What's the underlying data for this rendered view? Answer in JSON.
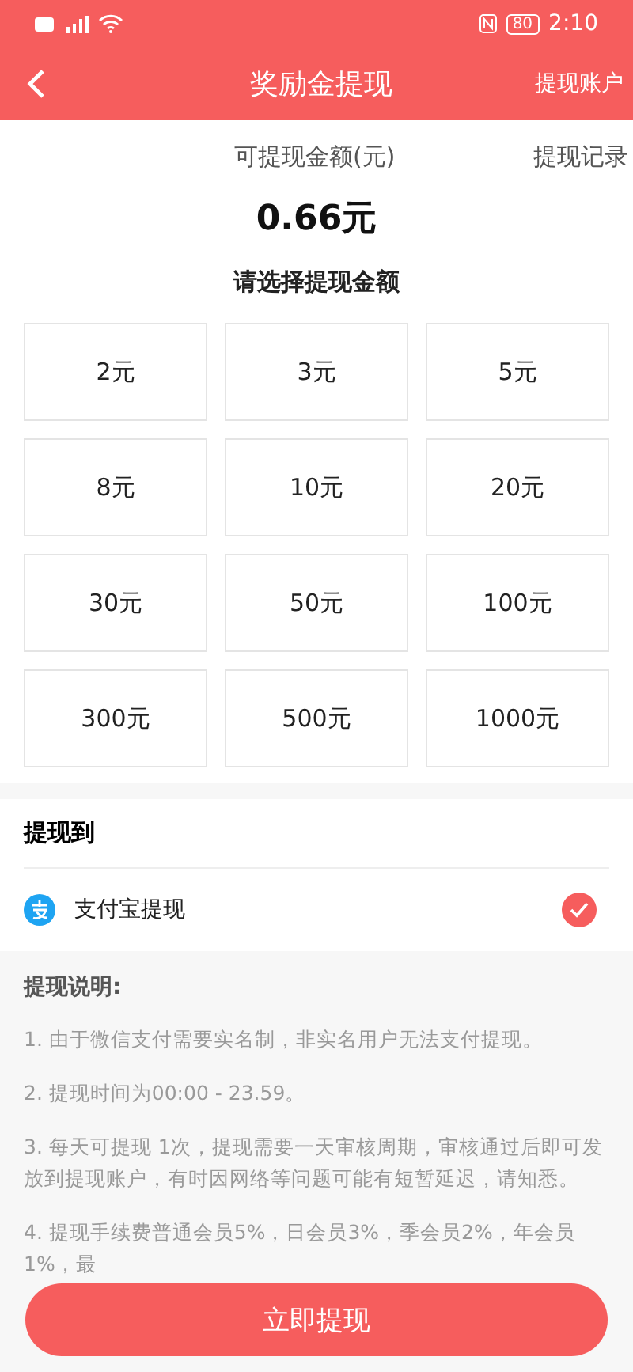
{
  "status_bar": {
    "battery": "80",
    "time": "2:10"
  },
  "header": {
    "title": "奖励金提现",
    "action": "提现账户"
  },
  "balance": {
    "label": "可提现金额(元)",
    "record_link": "提现记录",
    "amount": "0.66元"
  },
  "amount_prompt": "请选择提现金额",
  "amounts": [
    "2元",
    "3元",
    "5元",
    "8元",
    "10元",
    "20元",
    "30元",
    "50元",
    "100元",
    "300元",
    "500元",
    "1000元"
  ],
  "withdraw_to": {
    "title": "提现到",
    "methods": [
      {
        "label": "支付宝提现",
        "checked": true
      }
    ]
  },
  "notes": {
    "title": "提现说明:",
    "items": [
      "1. 由于微信支付需要实名制，非实名用户无法支付提现。",
      "2. 提现时间为00:00 - 23.59。",
      "3. 每天可提现 1次，提现需要一天审核周期，审核通过后即可发放到提现账户，有时因网络等问题可能有短暂延迟，请知悉。",
      "4. 提现手续费普通会员5%，日会员3%，季会员2%，年会员1%，最"
    ]
  },
  "submit": "立即提现"
}
